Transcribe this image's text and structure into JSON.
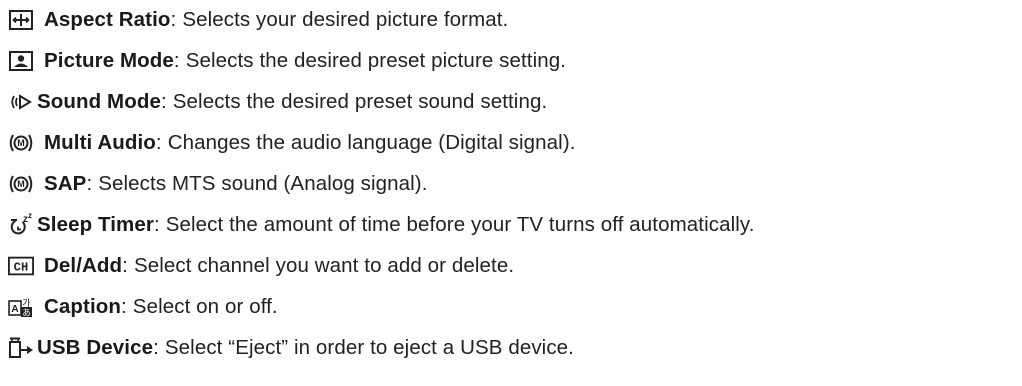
{
  "items": [
    {
      "icon": "aspect-ratio-icon",
      "label": "Aspect Ratio",
      "desc": "Selects your desired picture format."
    },
    {
      "icon": "picture-mode-icon",
      "label": "Picture Mode",
      "desc": "Selects the desired preset picture setting."
    },
    {
      "icon": "sound-mode-icon",
      "label": "Sound Mode",
      "desc": "Selects the desired preset sound setting."
    },
    {
      "icon": "multi-audio-icon",
      "label": "Multi Audio",
      "desc": "Changes the audio language (Digital signal)."
    },
    {
      "icon": "sap-icon",
      "label": "SAP",
      "desc": "Selects MTS sound (Analog signal)."
    },
    {
      "icon": "sleep-timer-icon",
      "label": "Sleep Timer",
      "desc": "Select the amount of time before your TV turns off automatically."
    },
    {
      "icon": "ch-del-add-icon",
      "label": "Del/Add",
      "desc": "Select channel you want to add or delete."
    },
    {
      "icon": "caption-icon",
      "label": "Caption",
      "desc": "Select on or off."
    },
    {
      "icon": "usb-device-icon",
      "label": "USB Device",
      "desc": "Select “Eject” in order to eject a USB device."
    }
  ],
  "icon_text": {
    "ch": "CH",
    "multi_audio_letter": "M",
    "sap_letter": "M",
    "sleep_z": "z",
    "caption_a": "A",
    "caption_k": "가",
    "caption_j": "あ"
  },
  "colon": ":"
}
